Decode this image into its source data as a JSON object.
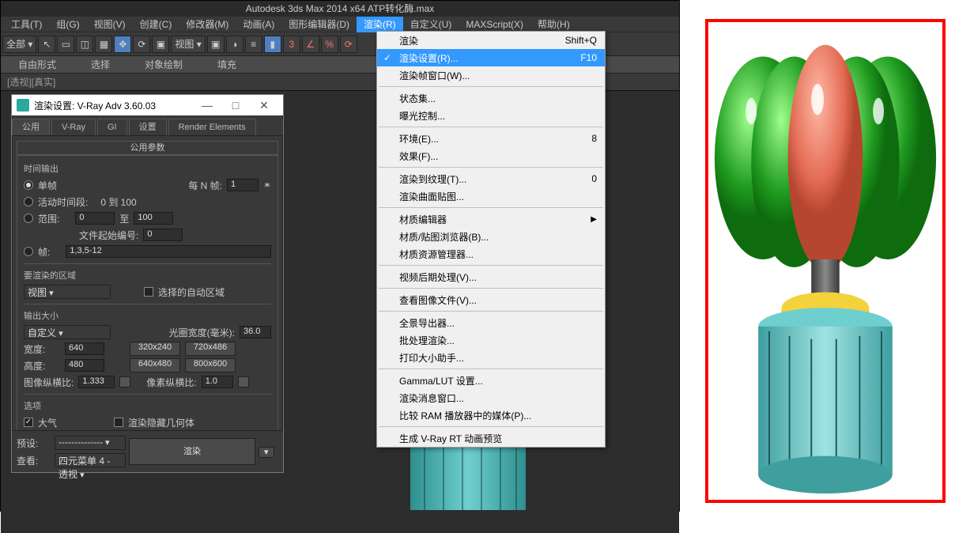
{
  "title": "Autodesk 3ds Max 2014 x64    ATP转化酶.max",
  "menubar": [
    "工具(T)",
    "组(G)",
    "视图(V)",
    "创建(C)",
    "修改器(M)",
    "动画(A)",
    "图形编辑器(D)",
    "渲染(R)",
    "自定义(U)",
    "MAXScript(X)",
    "帮助(H)"
  ],
  "menubar_active_index": 7,
  "toolbar_select": "全部",
  "toolbar_view": "视图",
  "ribbon": [
    "自由形式",
    "选择",
    "对象绘制",
    "填充"
  ],
  "vp_label": "[透视][真实]",
  "dropdown": {
    "groups": [
      [
        {
          "label": "渲染",
          "shortcut": "Shift+Q"
        },
        {
          "label": "渲染设置(R)...",
          "shortcut": "F10",
          "selected": true,
          "checked": true
        },
        {
          "label": "渲染帧窗口(W)..."
        }
      ],
      [
        {
          "label": "状态集..."
        },
        {
          "label": "曝光控制..."
        }
      ],
      [
        {
          "label": "环境(E)...",
          "shortcut": "8"
        },
        {
          "label": "效果(F)..."
        }
      ],
      [
        {
          "label": "渲染到纹理(T)...",
          "shortcut": "0"
        },
        {
          "label": "渲染曲面贴图..."
        }
      ],
      [
        {
          "label": "材质编辑器",
          "submenu": true
        },
        {
          "label": "材质/贴图浏览器(B)..."
        },
        {
          "label": "材质资源管理器..."
        }
      ],
      [
        {
          "label": "视频后期处理(V)..."
        }
      ],
      [
        {
          "label": "查看图像文件(V)..."
        }
      ],
      [
        {
          "label": "全景导出器..."
        },
        {
          "label": "批处理渲染..."
        },
        {
          "label": "打印大小助手..."
        }
      ],
      [
        {
          "label": "Gamma/LUT 设置..."
        },
        {
          "label": "渲染消息窗口..."
        },
        {
          "label": "比较 RAM 播放器中的媒体(P)..."
        }
      ],
      [
        {
          "label": "生成 V-Ray RT 动画预览"
        }
      ]
    ]
  },
  "dlg": {
    "title": "渲染设置: V-Ray Adv 3.60.03",
    "tabs": [
      "公用",
      "V-Ray",
      "GI",
      "设置",
      "Render Elements"
    ],
    "active_tab": 0,
    "rollout": "公用参数",
    "time_group": "时间输出",
    "opt_single": "单帧",
    "every_n_label": "每 N 帧:",
    "every_n": "1",
    "opt_active": "活动时间段:",
    "active_range": "0 到 100",
    "opt_range": "范围:",
    "range_from": "0",
    "range_to_lbl": "至",
    "range_to": "100",
    "file_start": "文件起始编号:",
    "file_start_v": "0",
    "opt_frames": "帧:",
    "frames_v": "1,3,5-12",
    "area_group": "要渲染的区域",
    "area_v": "视图",
    "auto_region": "选择的自动区域",
    "out_group": "输出大小",
    "out_preset": "自定义",
    "aperture_lbl": "光圈宽度(毫米):",
    "aperture_v": "36.0",
    "width_lbl": "宽度:",
    "width_v": "640",
    "height_lbl": "高度:",
    "height_v": "480",
    "presets": [
      "320x240",
      "720x486",
      "640x480",
      "800x600"
    ],
    "img_aspect_lbl": "图像纵横比:",
    "img_aspect_v": "1.333",
    "pix_aspect_lbl": "像素纵横比:",
    "pix_aspect_v": "1.0",
    "options_group": "选项",
    "opt_atm": "大气",
    "opt_hidden": "渲染隐藏几何体",
    "preset_lbl": "预设:",
    "preset_v": "--------------",
    "view_lbl": "查看:",
    "view_v": "四元菜单 4 - 透视",
    "render_btn": "渲染"
  }
}
